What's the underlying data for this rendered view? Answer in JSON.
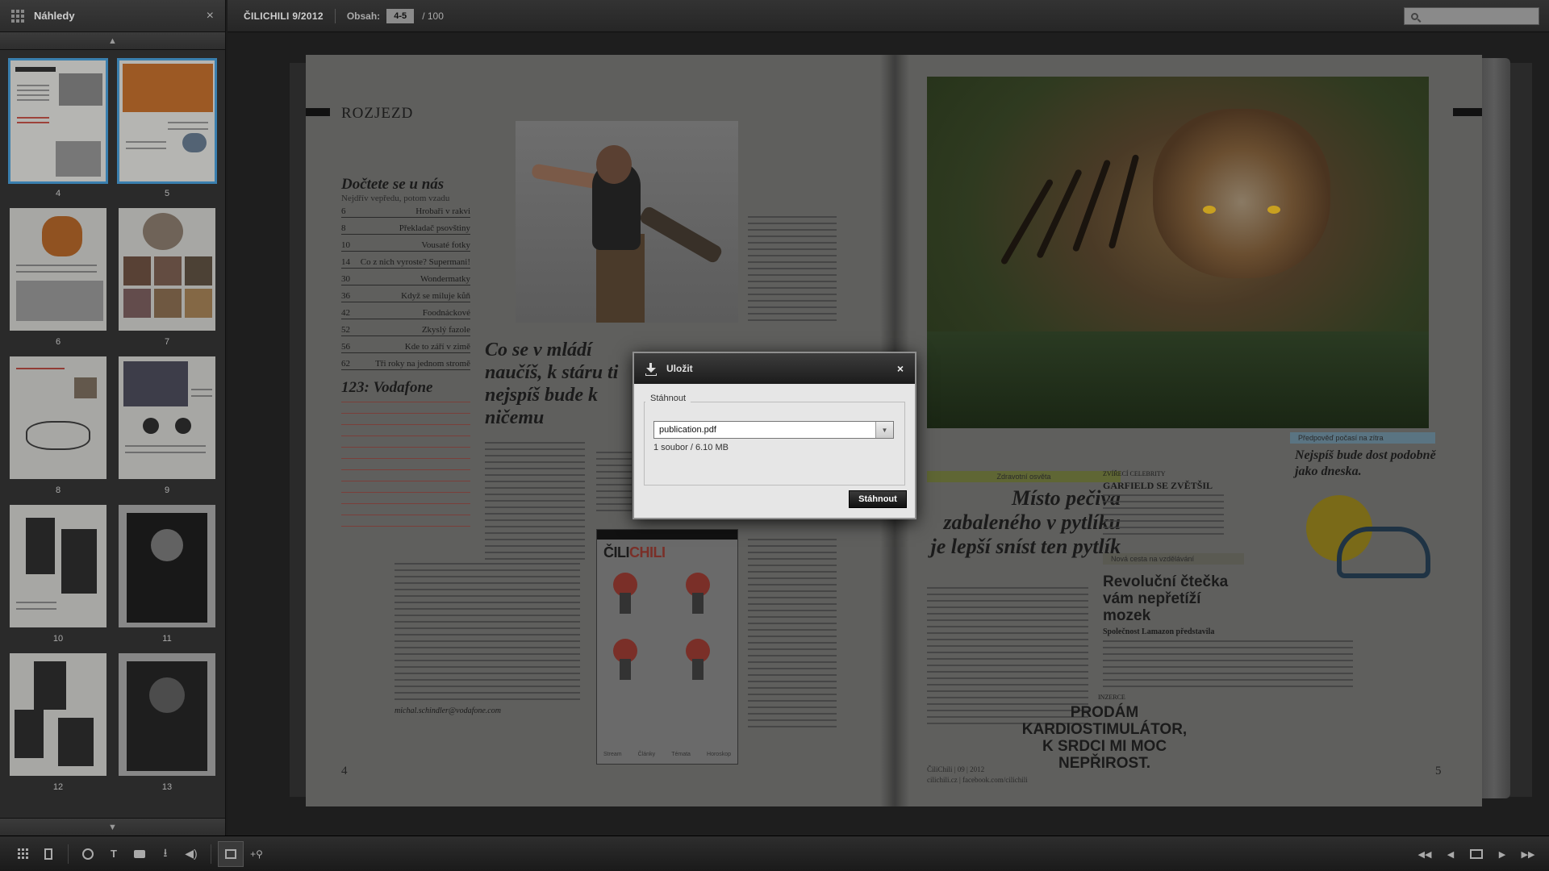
{
  "sidebar": {
    "title": "Náhledy",
    "close_glyph": "×",
    "thumbnails": [
      {
        "page": "4",
        "selected": true
      },
      {
        "page": "5",
        "selected": true
      },
      {
        "page": "6",
        "selected": false
      },
      {
        "page": "7",
        "selected": false
      },
      {
        "page": "8",
        "selected": false
      },
      {
        "page": "9",
        "selected": false
      },
      {
        "page": "10",
        "selected": false
      },
      {
        "page": "11",
        "selected": false
      },
      {
        "page": "12",
        "selected": false
      },
      {
        "page": "13",
        "selected": false
      }
    ]
  },
  "topbar": {
    "publication_title": "ČILICHILI 9/2012",
    "content_label": "Obsah:",
    "current_pages": "4-5",
    "total_pages": "/ 100",
    "search_placeholder": ""
  },
  "magazine": {
    "left": {
      "section": "ROZJEZD",
      "toc_title": "Dočtete se u nás",
      "toc_subtitle": "Nejdřív vepředu, potom vzadu",
      "toc": [
        {
          "num": "6",
          "title": "Hrobaři v rakvi"
        },
        {
          "num": "8",
          "title": "Překladač psovštiny"
        },
        {
          "num": "10",
          "title": "Vousaté fotky"
        },
        {
          "num": "14",
          "title": "Co z nich vyroste? Supermani!"
        },
        {
          "num": "30",
          "title": "Wondermatky"
        },
        {
          "num": "36",
          "title": "Když se miluje kůň"
        },
        {
          "num": "42",
          "title": "Foodnáckové"
        },
        {
          "num": "52",
          "title": "Zkyslý fazole"
        },
        {
          "num": "56",
          "title": "Kde to září v zimě"
        },
        {
          "num": "62",
          "title": "Tři roky na jednom stromě"
        }
      ],
      "vodafone_title": "123: Vodafone",
      "quote": "Co se v mládí naučíš, k stáru ti nejspíš bude k ničemu",
      "phone_logo_a": "ČILI",
      "phone_logo_b": "CHILI",
      "phone_tabs": [
        "Stream",
        "Články",
        "Témata",
        "Horoskop"
      ],
      "email": "michal.schindler@vodafone.com",
      "page_number": "4"
    },
    "right": {
      "tag_forecast": "Předpověď počasí na zítra",
      "weather_text": "Nejspíš bude dost podobně jako dneska.",
      "tag_health": "Zdravotní osvěta",
      "headline": "Místo pečiva zabaleného v pytlíku je lepší sníst ten pytlík",
      "garfield_kicker": "ZVÍŘECÍ CELEBRITY",
      "garfield_title": "GARFIELD SE ZVĚTŠIL",
      "tag_new_reader": "Nová cesta na vzdělávání",
      "reader_headline": "Revoluční čtečka vám nepřetíží mozek",
      "lamazon": "Společnost Lamazon představila",
      "ad_kicker": "INZERCE",
      "ad_text": "PRODÁM KARDIOSTIMULÁTOR, K SRDCI MI MOC NEPŘIROST.",
      "footer_line1": "ČiliChili | 09 | 2012",
      "footer_line2": "cilichili.cz | facebook.com/cilichili",
      "page_number": "5"
    }
  },
  "dialog": {
    "title": "Uložit",
    "close_glyph": "×",
    "group_label": "Stáhnout",
    "file_value": "publication.pdf",
    "file_info": "1 soubor / 6.10 MB",
    "button_label": "Stáhnout"
  },
  "icons": {
    "nav_prev": "◀",
    "nav_next": "▶",
    "scroll_up": "▲",
    "scroll_down": "▼"
  },
  "bottombar": {
    "tools": [
      "thumbnails-icon",
      "bookmark-icon",
      "globe-icon",
      "text-icon",
      "print-icon",
      "download-icon",
      "sound-icon",
      "fit-icon",
      "zoom-icon"
    ],
    "nav": [
      "first-page-icon",
      "prev-page-icon",
      "double-page-icon",
      "next-page-icon",
      "last-page-icon"
    ]
  }
}
